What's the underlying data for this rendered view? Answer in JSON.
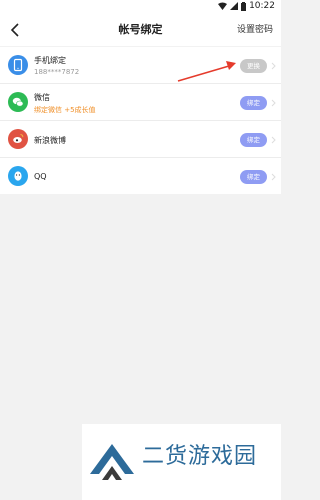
{
  "status": {
    "time": "10:22"
  },
  "nav": {
    "title": "帐号绑定",
    "action": "设置密码"
  },
  "accounts": [
    {
      "name": "手机绑定",
      "detail": "188****7872",
      "button": "更换",
      "icon": "phone-icon",
      "color": "#3a8ee8"
    },
    {
      "name": "微信",
      "detail": "绑定微信 +5成长值",
      "button": "绑定",
      "icon": "wechat-icon",
      "color": "#2dbb55"
    },
    {
      "name": "新浪微博",
      "button": "绑定",
      "icon": "weibo-icon",
      "color": "#e05343"
    },
    {
      "name": "QQ",
      "button": "绑定",
      "icon": "qq-icon",
      "color": "#2aa6ee"
    }
  ],
  "watermark": {
    "text": "二货游戏园"
  }
}
